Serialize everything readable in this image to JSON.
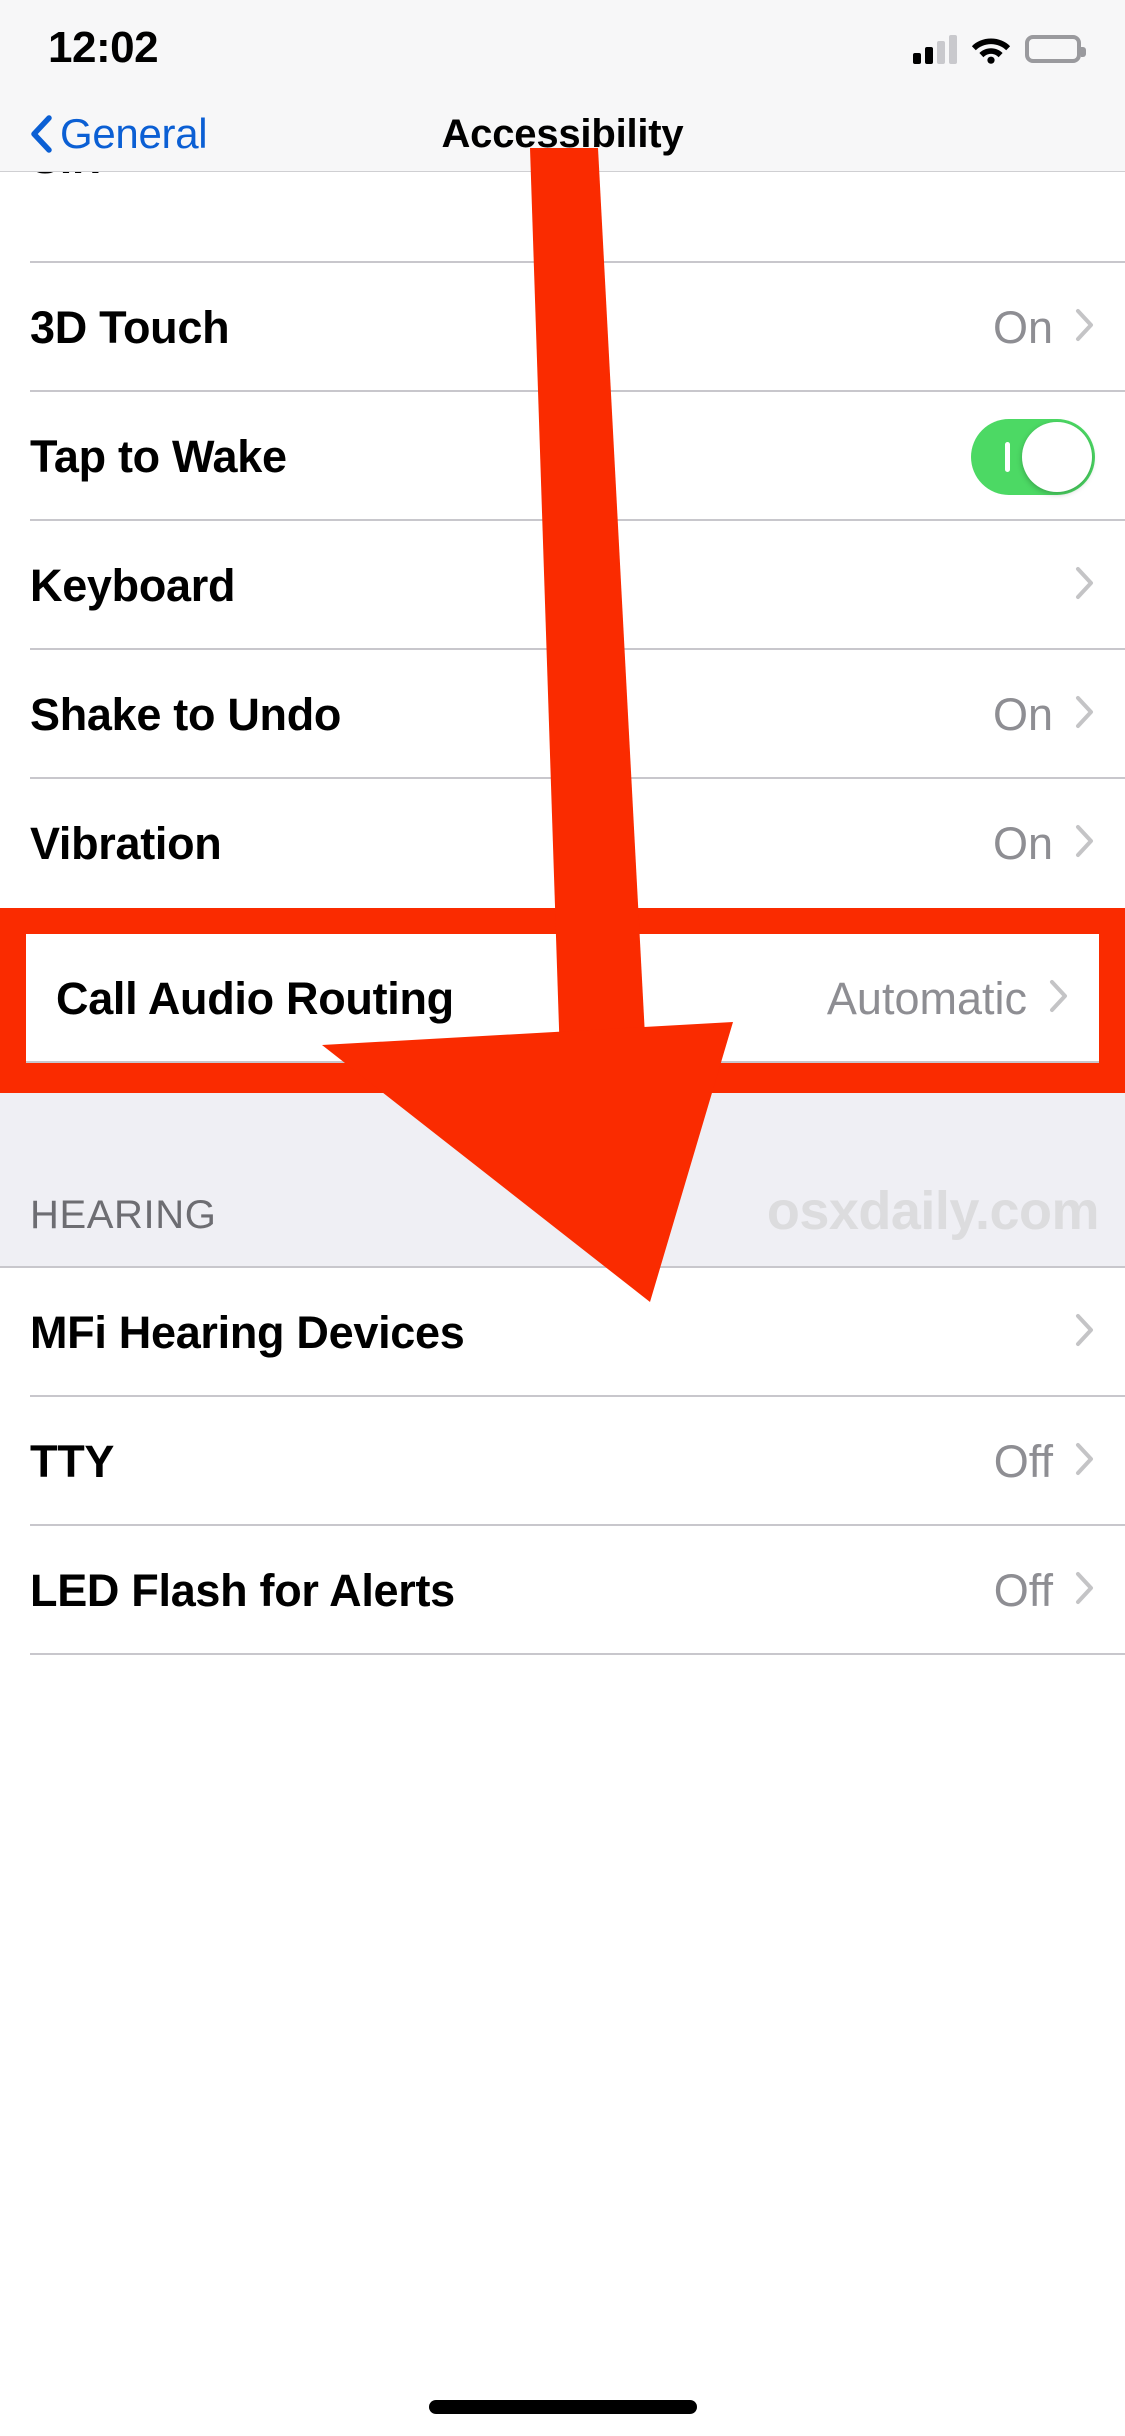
{
  "status_bar": {
    "time": "12:02",
    "signal_bars_total": 4,
    "signal_bars_filled": 2,
    "wifi": "wifi-icon",
    "battery": "battery-full-icon"
  },
  "nav": {
    "back_label": "General",
    "back_icon": "chevron-left-icon",
    "title": "Accessibility"
  },
  "rows": [
    {
      "title": "Siri",
      "value": "",
      "accessory": "chevron",
      "clipped": true
    },
    {
      "title": "3D Touch",
      "value": "On",
      "accessory": "chevron"
    },
    {
      "title": "Tap to Wake",
      "value": "",
      "accessory": "switch",
      "switch_on": true
    },
    {
      "title": "Keyboard",
      "value": "",
      "accessory": "chevron"
    },
    {
      "title": "Shake to Undo",
      "value": "On",
      "accessory": "chevron"
    },
    {
      "title": "Vibration",
      "value": "On",
      "accessory": "chevron"
    }
  ],
  "highlighted_row": {
    "title": "Call Audio Routing",
    "value": "Automatic",
    "accessory": "chevron",
    "highlight_color": "#fa2b00"
  },
  "section": {
    "label": "HEARING",
    "watermark": "osxdaily.com"
  },
  "hearing_rows": [
    {
      "title": "MFi Hearing Devices",
      "value": "",
      "accessory": "chevron"
    },
    {
      "title": "TTY",
      "value": "Off",
      "accessory": "chevron"
    },
    {
      "title": "LED Flash for Alerts",
      "value": "Off",
      "accessory": "chevron"
    }
  ],
  "annotation": {
    "arrow_color": "#fa2b00",
    "arrow_description": "red-down-arrow-pointing-to-call-audio-routing"
  },
  "colors": {
    "tint_blue": "#0b5fd4",
    "switch_green": "#4cd964",
    "value_gray": "#8e8e93",
    "separator": "#c8c7cc",
    "group_background": "#efeff4",
    "bar_background": "#f7f7f8"
  }
}
